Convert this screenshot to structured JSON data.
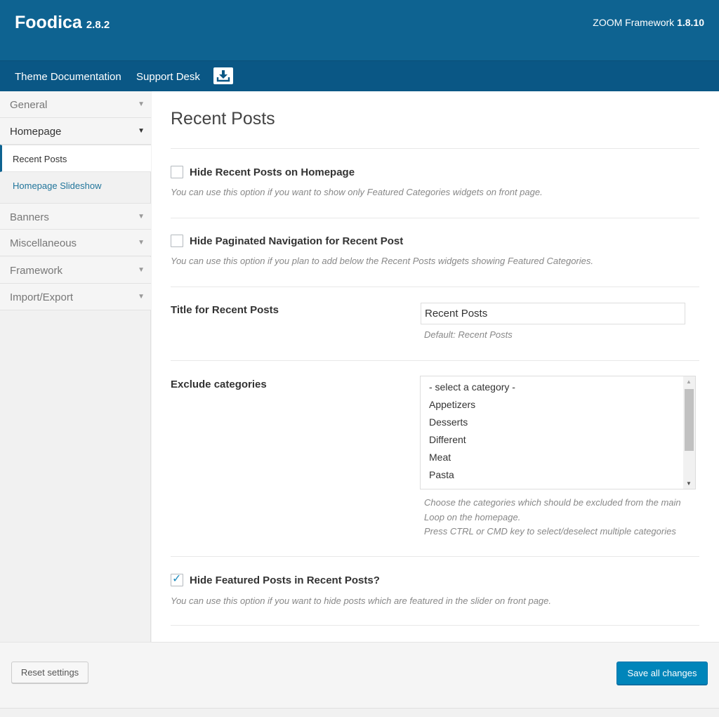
{
  "header": {
    "app_name": "Foodica",
    "app_version": "2.8.2",
    "framework_label": "ZOOM Framework",
    "framework_version": "1.8.10"
  },
  "nav": {
    "docs_label": "Theme Documentation",
    "support_label": "Support Desk",
    "download_icon": "download-icon"
  },
  "sidebar": {
    "items": [
      {
        "label": "General"
      },
      {
        "label": "Homepage"
      },
      {
        "label": "Banners"
      },
      {
        "label": "Miscellaneous"
      },
      {
        "label": "Framework"
      },
      {
        "label": "Import/Export"
      }
    ],
    "sub_items": [
      {
        "label": "Recent Posts"
      },
      {
        "label": "Homepage Slideshow"
      }
    ]
  },
  "main": {
    "title": "Recent Posts",
    "options": [
      {
        "label": "Hide Recent Posts on Homepage",
        "checked": false,
        "description": "You can use this option if you want to show only Featured Categories widgets on front page."
      },
      {
        "label": "Hide Paginated Navigation for Recent Post",
        "checked": false,
        "description": "You can use this option if you plan to add below the Recent Posts widgets showing Featured Categories."
      },
      {
        "label": "Hide Featured Posts in Recent Posts?",
        "checked": true,
        "description": "You can use this option if you want to hide posts which are featured in the slider on front page."
      }
    ],
    "title_field": {
      "label": "Title for Recent Posts",
      "value": "Recent Posts",
      "hint": "Default: Recent Posts"
    },
    "exclude": {
      "label": "Exclude categories",
      "options": [
        "- select a category -",
        "Appetizers",
        "Desserts",
        "Different",
        "Meat",
        "Pasta"
      ],
      "hint_line1": "Choose the categories which should be excluded from the main",
      "hint_line2": "Loop on the homepage.",
      "hint_line3": "Press CTRL or CMD key to select/deselect multiple categories"
    }
  },
  "footer": {
    "reset_label": "Reset settings",
    "save_label": "Save all changes"
  },
  "colors": {
    "header_bg": "#0e6391",
    "nav_bg": "#0a5785",
    "primary_button": "#0085ba",
    "link": "#21759b"
  }
}
